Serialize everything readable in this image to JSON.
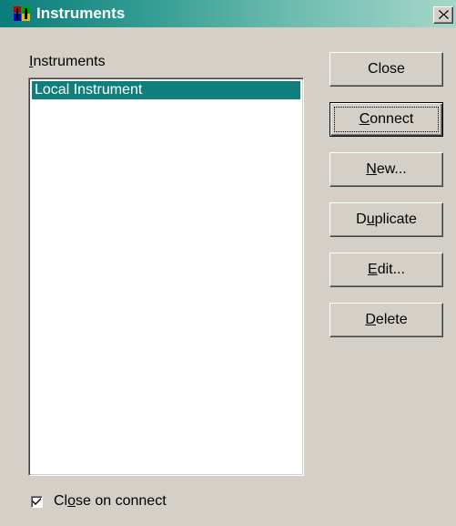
{
  "window": {
    "title": "Instruments",
    "title_color": "#0b7d7a",
    "close_icon": "close-icon"
  },
  "list": {
    "label": "Instruments",
    "label_mnemonic": "I",
    "label_rest": "nstruments",
    "items": [
      {
        "label": "Local Instrument",
        "selected": true
      }
    ],
    "selection_color": "#0e7f7c"
  },
  "buttons": {
    "close": {
      "label": "Close"
    },
    "connect": {
      "label": "Connect",
      "mnemonic": "C",
      "rest": "onnect"
    },
    "new": {
      "label": "New...",
      "mnemonic": "N",
      "rest": "ew..."
    },
    "duplicate": {
      "label": "Duplicate",
      "pre": "D",
      "mnemonic": "u",
      "rest": "plicate"
    },
    "edit": {
      "label": "Edit...",
      "mnemonic": "E",
      "rest": "dit..."
    },
    "delete": {
      "label": "Delete",
      "mnemonic": "D",
      "rest": "elete"
    }
  },
  "options": {
    "close_on_connect": {
      "label": "Close on connect",
      "pre": "Cl",
      "mnemonic": "o",
      "rest": "se on connect",
      "checked": true
    }
  }
}
